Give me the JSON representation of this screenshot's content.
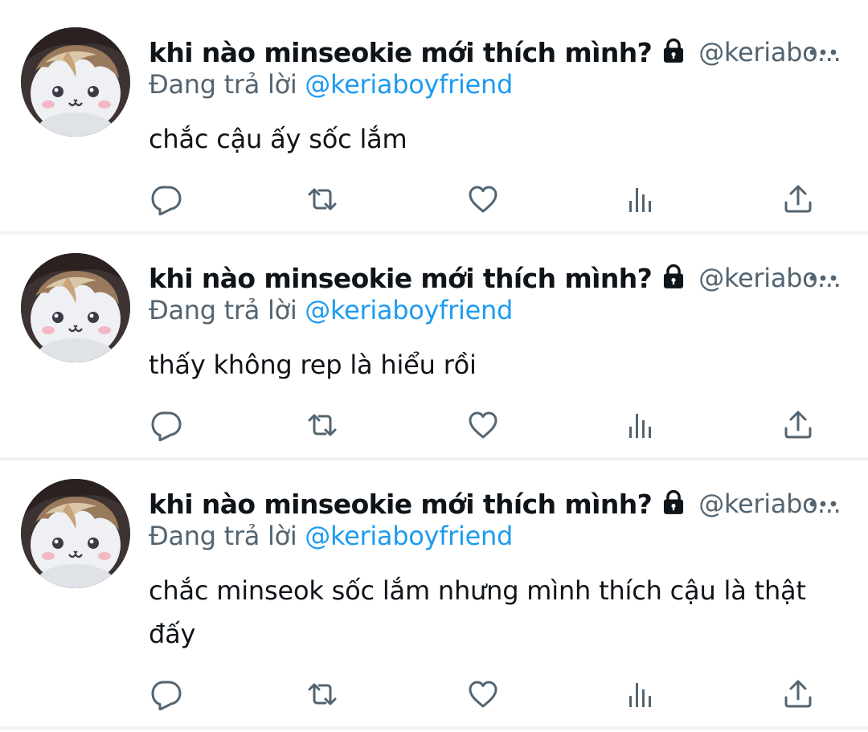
{
  "colors": {
    "text_primary": "#0f1419",
    "text_secondary": "#536471",
    "link": "#1d9bf0",
    "divider": "#eff3f4"
  },
  "tweets": [
    {
      "display_name": "khi nào minseokie mới thích mình?",
      "protected": true,
      "handle": "@keriabo...",
      "reply_prefix": "Đang trả lời",
      "reply_to": "@keriaboyfriend",
      "text_lines": [
        "chắc cậu ấy sốc lắm"
      ],
      "icons": [
        "reply-icon",
        "retweet-icon",
        "like-icon",
        "views-icon",
        "share-icon"
      ]
    },
    {
      "display_name": "khi nào minseokie mới thích mình?",
      "protected": true,
      "handle": "@keriabo...",
      "reply_prefix": "Đang trả lời",
      "reply_to": "@keriaboyfriend",
      "text_lines": [
        "thấy không rep là hiểu rồi"
      ],
      "icons": [
        "reply-icon",
        "retweet-icon",
        "like-icon",
        "views-icon",
        "share-icon"
      ]
    },
    {
      "display_name": "khi nào minseokie mới thích mình?",
      "protected": true,
      "handle": "@keriabo...",
      "reply_prefix": "Đang trả lời",
      "reply_to": "@keriaboyfriend",
      "text_lines": [
        "chắc minseok sốc lắm nhưng mình thích cậu là thật",
        "đấy"
      ],
      "icons": [
        "reply-icon",
        "retweet-icon",
        "like-icon",
        "views-icon",
        "share-icon"
      ]
    }
  ]
}
